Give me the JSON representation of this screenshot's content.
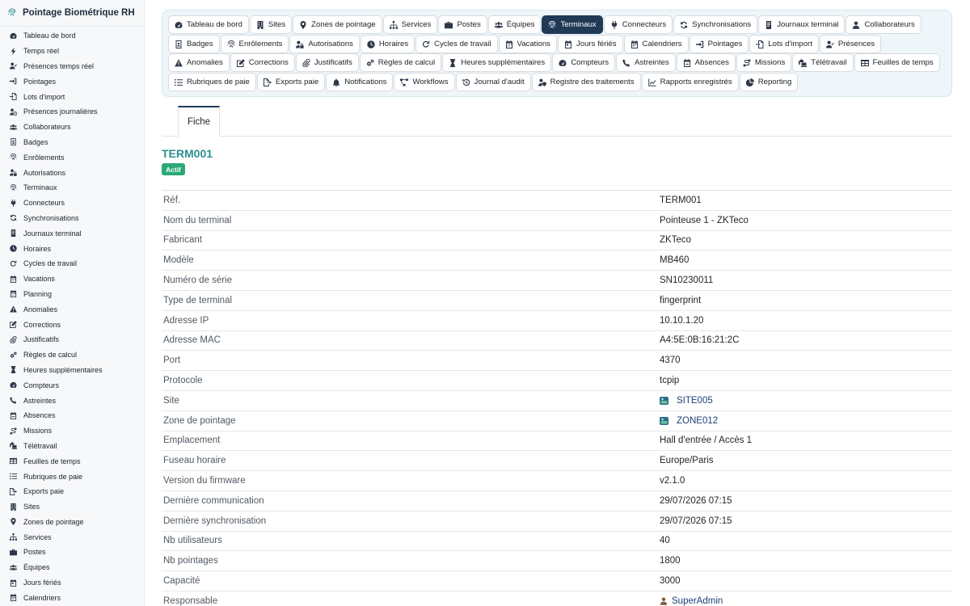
{
  "app": {
    "title": "Pointage Biométrique RH"
  },
  "sidebar": {
    "items": [
      {
        "label": "Tableau de bord",
        "icon": "gauge-icon"
      },
      {
        "label": "Temps réel",
        "icon": "bolt-icon"
      },
      {
        "label": "Présences temps réel",
        "icon": "user-check-icon"
      },
      {
        "label": "Pointages",
        "icon": "sign-in-icon"
      },
      {
        "label": "Lots d'import",
        "icon": "file-import-icon"
      },
      {
        "label": "Présences journalières",
        "icon": "user-clock-icon"
      },
      {
        "label": "Collaborateurs",
        "icon": "users-icon"
      },
      {
        "label": "Badges",
        "icon": "id-badge-icon"
      },
      {
        "label": "Enrôlements",
        "icon": "fingerprint-icon"
      },
      {
        "label": "Autorisations",
        "icon": "user-lock-icon"
      },
      {
        "label": "Terminaux",
        "icon": "fingerprint-icon"
      },
      {
        "label": "Connecteurs",
        "icon": "plug-icon"
      },
      {
        "label": "Synchronisations",
        "icon": "sync-icon"
      },
      {
        "label": "Journaux terminal",
        "icon": "scroll-icon"
      },
      {
        "label": "Horaires",
        "icon": "clock-icon"
      },
      {
        "label": "Cycles de travail",
        "icon": "redo-icon"
      },
      {
        "label": "Vacations",
        "icon": "calendar-icon"
      },
      {
        "label": "Planning",
        "icon": "calendar-icon"
      },
      {
        "label": "Anomalies",
        "icon": "warning-icon"
      },
      {
        "label": "Corrections",
        "icon": "edit-icon"
      },
      {
        "label": "Justificatifs",
        "icon": "paperclip-icon"
      },
      {
        "label": "Règles de calcul",
        "icon": "cogs-icon"
      },
      {
        "label": "Heures supplémentaires",
        "icon": "hourglass-icon"
      },
      {
        "label": "Compteurs",
        "icon": "gauge-icon"
      },
      {
        "label": "Astreintes",
        "icon": "phone-icon"
      },
      {
        "label": "Absences",
        "icon": "calendar-minus-icon"
      },
      {
        "label": "Missions",
        "icon": "route-icon"
      },
      {
        "label": "Télétravail",
        "icon": "house-laptop-icon"
      },
      {
        "label": "Feuilles de temps",
        "icon": "table-icon"
      },
      {
        "label": "Rubriques de paie",
        "icon": "list-icon"
      },
      {
        "label": "Exports paie",
        "icon": "file-export-icon"
      },
      {
        "label": "Sites",
        "icon": "building-icon"
      },
      {
        "label": "Zones de pointage",
        "icon": "map-marker-icon"
      },
      {
        "label": "Services",
        "icon": "sitemap-icon"
      },
      {
        "label": "Postes",
        "icon": "briefcase-icon"
      },
      {
        "label": "Équipes",
        "icon": "users-icon"
      },
      {
        "label": "Jours fériés",
        "icon": "calendar-day-icon"
      },
      {
        "label": "Calendriers",
        "icon": "calendar-alt-icon"
      }
    ]
  },
  "nav": {
    "rows": [
      [
        {
          "label": "Tableau de bord",
          "icon": "gauge-icon"
        },
        {
          "label": "Sites",
          "icon": "building-icon"
        },
        {
          "label": "Zones de pointage",
          "icon": "map-marker-icon"
        },
        {
          "label": "Services",
          "icon": "sitemap-icon"
        },
        {
          "label": "Postes",
          "icon": "briefcase-icon"
        },
        {
          "label": "Équipes",
          "icon": "users-icon"
        },
        {
          "label": "Terminaux",
          "icon": "fingerprint-icon",
          "active": true
        },
        {
          "label": "Connecteurs",
          "icon": "plug-icon"
        },
        {
          "label": "Synchronisations",
          "icon": "sync-icon"
        },
        {
          "label": "Journaux terminal",
          "icon": "scroll-icon"
        },
        {
          "label": "Collaborateurs",
          "icon": "user-icon"
        }
      ],
      [
        {
          "label": "Badges",
          "icon": "id-badge-icon"
        },
        {
          "label": "Enrôlements",
          "icon": "fingerprint-icon"
        },
        {
          "label": "Autorisations",
          "icon": "user-lock-icon"
        },
        {
          "label": "Horaires",
          "icon": "clock-icon"
        },
        {
          "label": "Cycles de travail",
          "icon": "redo-icon"
        },
        {
          "label": "Vacations",
          "icon": "calendar-icon"
        },
        {
          "label": "Jours fériés",
          "icon": "calendar-day-icon"
        },
        {
          "label": "Calendriers",
          "icon": "calendar-alt-icon"
        },
        {
          "label": "Pointages",
          "icon": "sign-in-icon"
        },
        {
          "label": "Lots d'import",
          "icon": "file-import-icon"
        },
        {
          "label": "Présences",
          "icon": "user-check-icon"
        }
      ],
      [
        {
          "label": "Anomalies",
          "icon": "warning-icon"
        },
        {
          "label": "Corrections",
          "icon": "edit-icon"
        },
        {
          "label": "Justificatifs",
          "icon": "paperclip-icon"
        },
        {
          "label": "Règles de calcul",
          "icon": "cogs-icon"
        },
        {
          "label": "Heures supplémentaires",
          "icon": "hourglass-icon"
        },
        {
          "label": "Compteurs",
          "icon": "gauge-icon"
        },
        {
          "label": "Astreintes",
          "icon": "phone-icon"
        },
        {
          "label": "Absences",
          "icon": "calendar-minus-icon"
        },
        {
          "label": "Missions",
          "icon": "route-icon"
        },
        {
          "label": "Télétravail",
          "icon": "house-laptop-icon"
        },
        {
          "label": "Feuilles de temps",
          "icon": "table-icon"
        }
      ],
      [
        {
          "label": "Rubriques de paie",
          "icon": "list-icon"
        },
        {
          "label": "Exports paie",
          "icon": "file-export-icon"
        },
        {
          "label": "Notifications",
          "icon": "bell-icon"
        },
        {
          "label": "Workflows",
          "icon": "project-diagram-icon"
        },
        {
          "label": "Journal d'audit",
          "icon": "history-icon"
        },
        {
          "label": "Registre des traitements",
          "icon": "user-shield-icon"
        },
        {
          "label": "Rapports enregistrés",
          "icon": "chart-line-icon"
        },
        {
          "label": "Reporting",
          "icon": "chart-pie-icon"
        }
      ]
    ]
  },
  "tabs": {
    "fiche": "Fiche"
  },
  "record": {
    "title": "TERM001",
    "status": "Actif",
    "status_color": "#2aa876",
    "fields": [
      {
        "label": "Réf.",
        "value": "TERM001"
      },
      {
        "label": "Nom du terminal",
        "value": "Pointeuse 1 - ZKTeco"
      },
      {
        "label": "Fabricant",
        "value": "ZKTeco"
      },
      {
        "label": "Modèle",
        "value": "MB460"
      },
      {
        "label": "Numéro de série",
        "value": "SN10230011"
      },
      {
        "label": "Type de terminal",
        "value": "fingerprint"
      },
      {
        "label": "Adresse IP",
        "value": "10.10.1.20"
      },
      {
        "label": "Adresse MAC",
        "value": "A4:5E:0B:16:21:2C"
      },
      {
        "label": "Port",
        "value": "4370"
      },
      {
        "label": "Protocole",
        "value": "tcpip"
      },
      {
        "label": "Site",
        "value": "SITE005",
        "link": true,
        "icon": "site-object-icon"
      },
      {
        "label": "Zone de pointage",
        "value": "ZONE012",
        "link": true,
        "icon": "zone-object-icon"
      },
      {
        "label": "Emplacement",
        "value": "Hall d'entrée / Accès 1"
      },
      {
        "label": "Fuseau horaire",
        "value": "Europe/Paris"
      },
      {
        "label": "Version du firmware",
        "value": "v2.1.0"
      },
      {
        "label": "Dernière communication",
        "value": "29/07/2026 07:15"
      },
      {
        "label": "Dernière synchronisation",
        "value": "29/07/2026 07:15"
      },
      {
        "label": "Nb utilisateurs",
        "value": "40"
      },
      {
        "label": "Nb pointages",
        "value": "1800"
      },
      {
        "label": "Capacité",
        "value": "3000"
      },
      {
        "label": "Responsable",
        "value": "SuperAdmin",
        "link": true,
        "icon": "user-icon"
      }
    ]
  },
  "colors": {
    "accent": "#2a8f8f",
    "active_nav": "#203a56",
    "link": "#1c3f78"
  }
}
